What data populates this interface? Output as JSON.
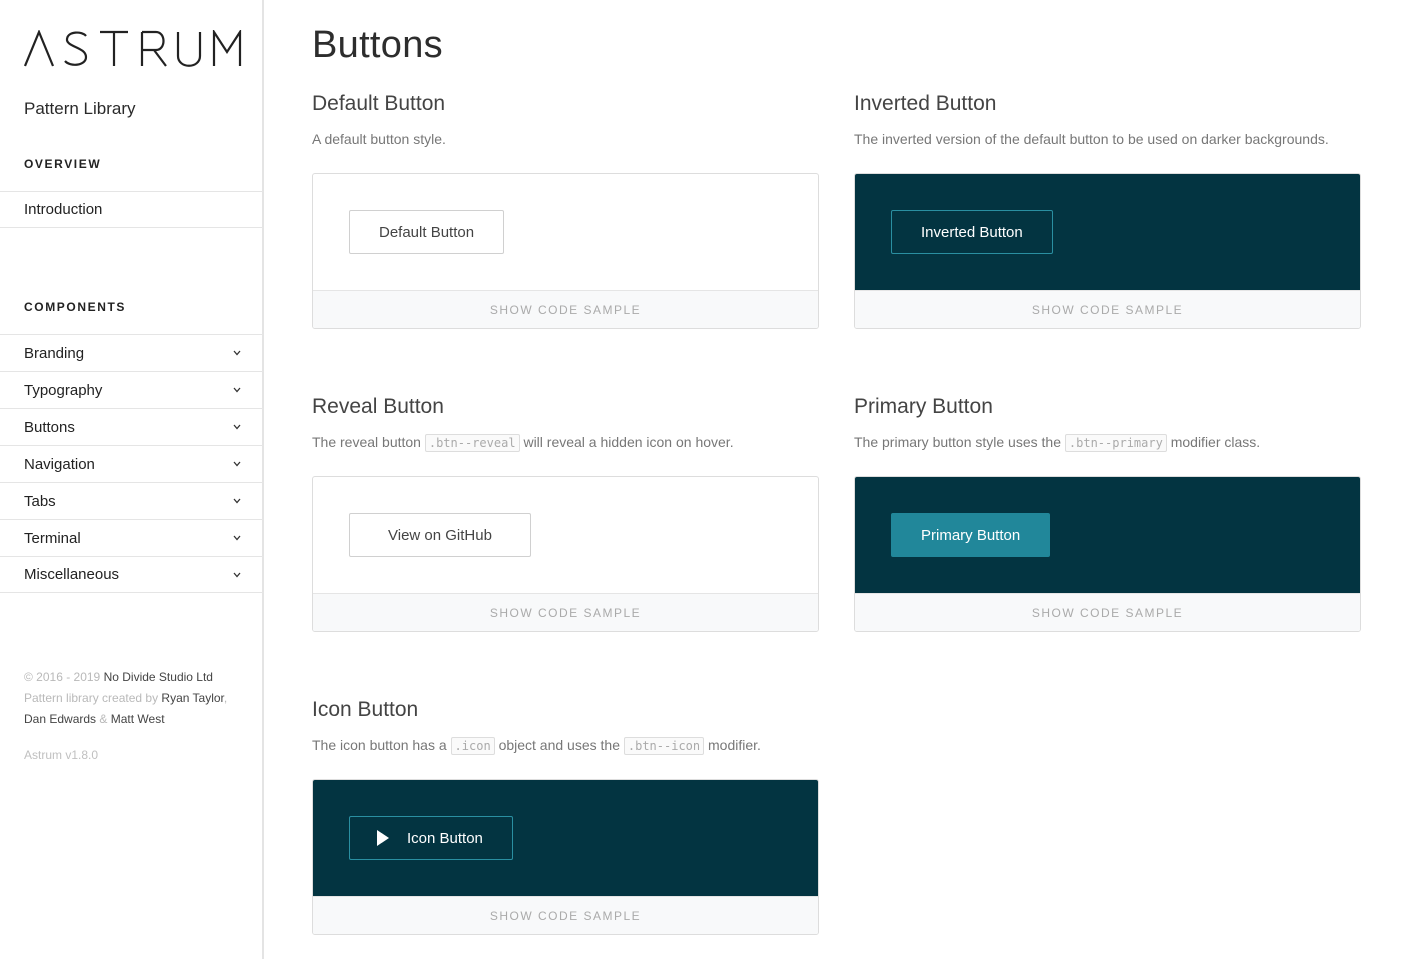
{
  "sidebar": {
    "logo_text": "ASTRUM",
    "subtitle": "Pattern Library",
    "overview_heading": "OVERVIEW",
    "overview_items": [
      {
        "label": "Introduction"
      }
    ],
    "components_heading": "COMPONENTS",
    "component_items": [
      {
        "label": "Branding"
      },
      {
        "label": "Typography"
      },
      {
        "label": "Buttons"
      },
      {
        "label": "Navigation"
      },
      {
        "label": "Tabs"
      },
      {
        "label": "Terminal"
      },
      {
        "label": "Miscellaneous"
      }
    ],
    "footer": {
      "copyright": "© 2016 - 2019",
      "company": "No Divide Studio Ltd",
      "created_by": "Pattern library created by",
      "author1": "Ryan Taylor",
      "author2": "Dan Edwards",
      "amp": "&",
      "author3": "Matt West",
      "version": "Astrum v1.8.0"
    }
  },
  "main": {
    "page_title": "Buttons",
    "show_code_label": "SHOW CODE SAMPLE",
    "cards": {
      "default": {
        "title": "Default Button",
        "desc": "A default button style.",
        "button": "Default Button"
      },
      "inverted": {
        "title": "Inverted Button",
        "desc": "The inverted version of the default button to be used on darker backgrounds.",
        "button": "Inverted Button"
      },
      "reveal": {
        "title": "Reveal Button",
        "desc_pre": "The reveal button",
        "code": ".btn--reveal",
        "desc_post": "will reveal a hidden icon on hover.",
        "button": "View on GitHub"
      },
      "primary": {
        "title": "Primary Button",
        "desc_pre": "The primary button style uses the",
        "code": ".btn--primary",
        "desc_post": "modifier class.",
        "button": "Primary Button"
      },
      "icon": {
        "title": "Icon Button",
        "desc_pre": "The icon button has a",
        "code1": ".icon",
        "desc_mid": "object and uses the",
        "code2": ".btn--icon",
        "desc_post": "modifier.",
        "button": "Icon Button",
        "icon": "play-icon"
      }
    }
  },
  "colors": {
    "dark_bg": "#033441",
    "primary": "#21879a",
    "inverted_border": "#2a8fa1"
  }
}
